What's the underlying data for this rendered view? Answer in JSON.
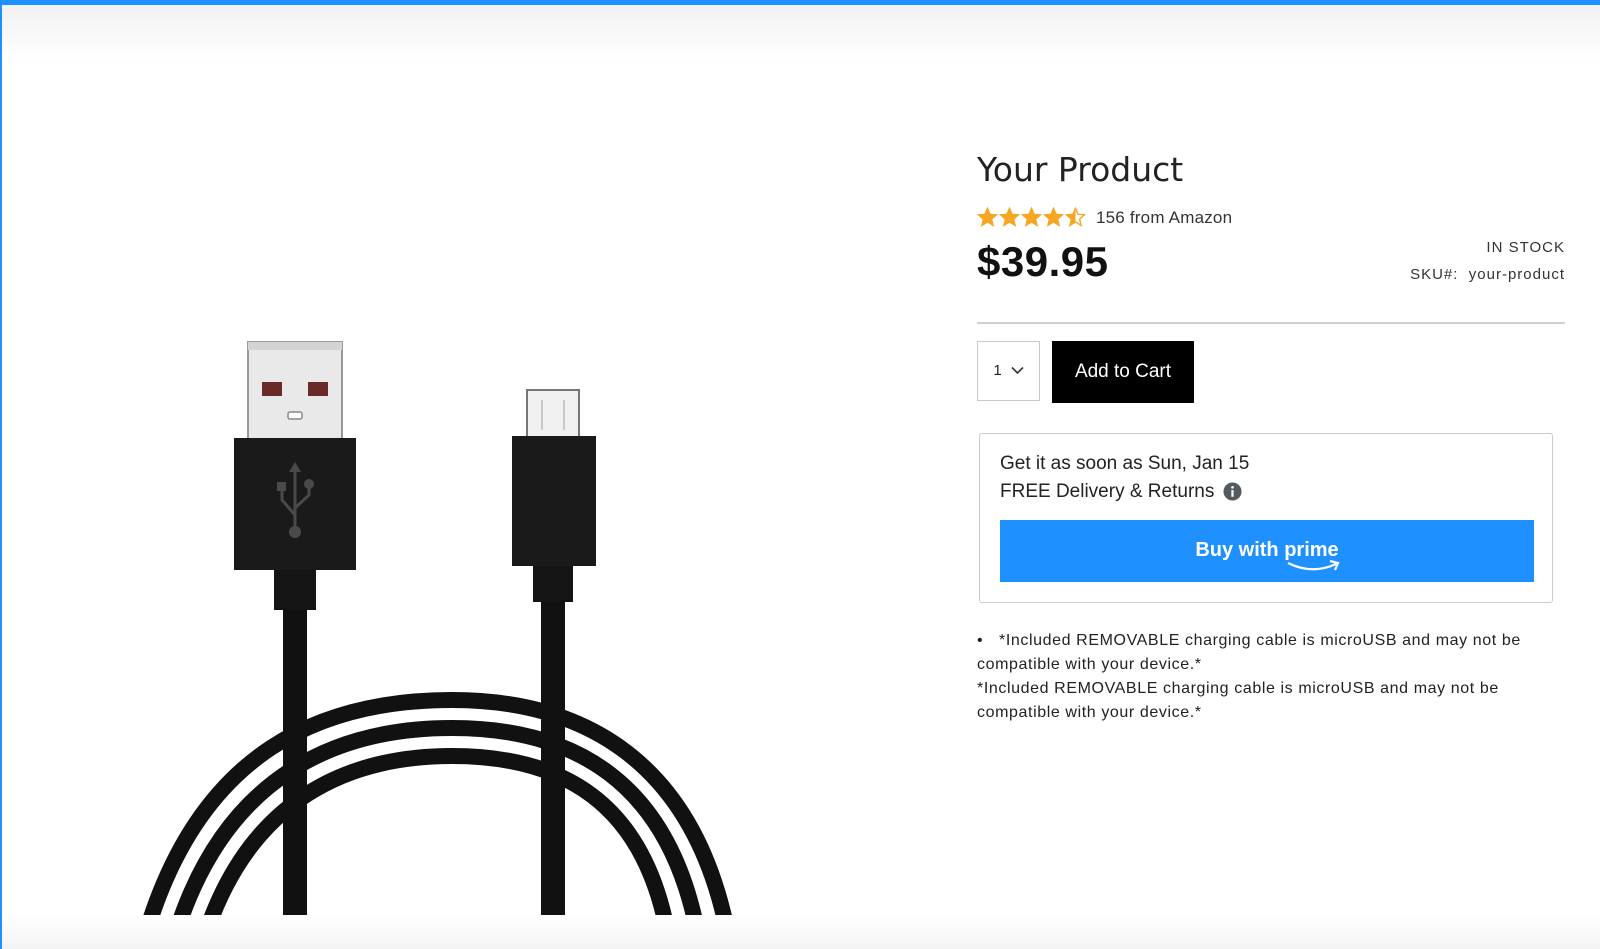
{
  "product": {
    "title": "Your Product",
    "rating_value": 4.5,
    "rating_max": 5,
    "rating_text": "156 from Amazon",
    "price": "$39.95",
    "stock_status": "IN STOCK",
    "sku_label": "SKU#:",
    "sku_value": "your-product",
    "image_description_icon": "usb-cable-image"
  },
  "cart": {
    "quantity": "1",
    "add_to_cart_label": "Add to Cart"
  },
  "delivery": {
    "eta_text": "Get it as soon as Sun, Jan 15",
    "returns_text": "FREE Delivery & Returns",
    "info_icon": "info-icon",
    "prime_button_prefix": "Buy with",
    "prime_button_brand": "prime"
  },
  "details": {
    "bullet_line_1": "*Included REMOVABLE charging cable is microUSB and may not be",
    "bullet_line_2": "compatible with your device.*",
    "repeat_line_1": "*Included REMOVABLE charging cable is microUSB and may not be",
    "repeat_line_2": "compatible with your device.*"
  },
  "colors": {
    "accent": "#1e90ff",
    "star": "#f5a623",
    "cart_button": "#000000"
  }
}
